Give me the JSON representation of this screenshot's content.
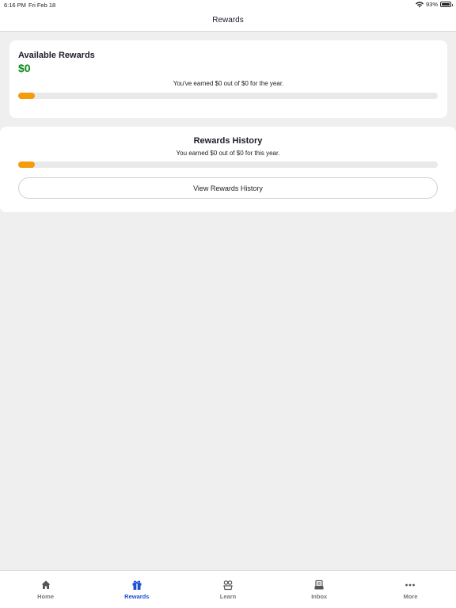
{
  "status_bar": {
    "time": "6:16 PM",
    "date": "Fri Feb 18",
    "battery": "93%"
  },
  "header": {
    "title": "Rewards"
  },
  "available_rewards": {
    "title": "Available Rewards",
    "amount": "$0",
    "note": "You've earned $0 out of $0 for the year.",
    "progress_fraction": 0.04
  },
  "rewards_history": {
    "title": "Rewards History",
    "note": "You earned $0 out of $0 for this year.",
    "progress_fraction": 0.04,
    "button_label": "View Rewards History"
  },
  "tabs": [
    {
      "label": "Home",
      "icon": "home-icon",
      "active": false
    },
    {
      "label": "Rewards",
      "icon": "gift-icon",
      "active": true
    },
    {
      "label": "Learn",
      "icon": "learn-icon",
      "active": false
    },
    {
      "label": "Inbox",
      "icon": "inbox-icon",
      "active": false
    },
    {
      "label": "More",
      "icon": "more-icon",
      "active": false
    }
  ],
  "colors": {
    "accent": "#1b4fd8",
    "amount_green": "#0a8a1a",
    "progress_orange": "#f59c0a",
    "background": "#efefef"
  }
}
